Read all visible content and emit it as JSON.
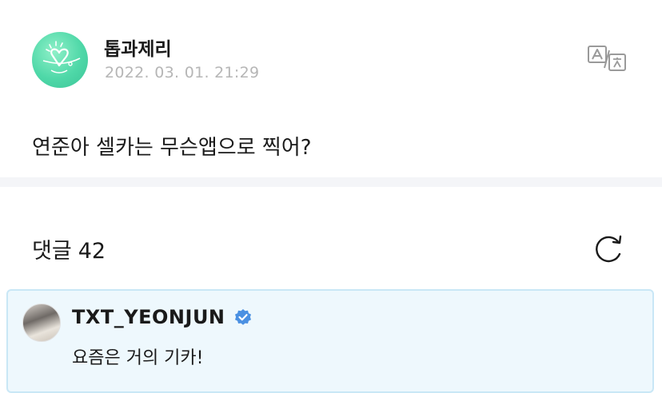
{
  "post": {
    "author": "톱과제리",
    "date": "2022. 03. 01. 21:29",
    "text": "연준아 셀카는 무슨앱으로 찍어?",
    "avatar_icon": "heart-doodle-logo",
    "translate_icon": "translate-icon"
  },
  "comments": {
    "label": "댓글",
    "count": "42",
    "refresh_icon": "refresh-icon"
  },
  "highlighted_comment": {
    "author": "TXT_YEONJUN",
    "verified_icon": "verified-badge-icon",
    "text": "요즘은 거의 기카!"
  },
  "colors": {
    "accent_green": "#4fd8a8",
    "highlight_bg": "#eef8fd",
    "highlight_border": "#c9e7f6",
    "verified_blue": "#4a90e2",
    "date_gray": "#b6b6b6"
  }
}
